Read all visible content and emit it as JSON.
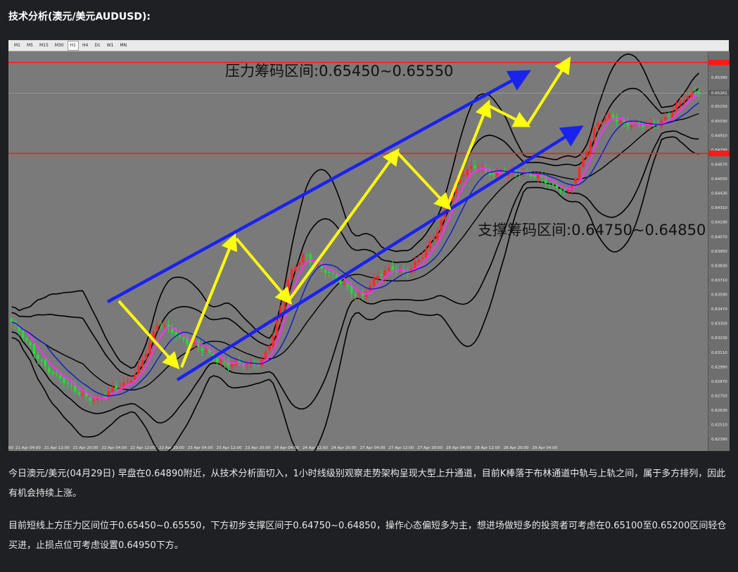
{
  "page": {
    "title": "技术分析(澳元/美元AUDUSD):",
    "paragraph1": "今日澳元/美元(04月29日) 早盘在0.64890附近，从技术分析面切入，1小时线级别观察走势架构呈现大型上升通道，目前K棒落于布林通道中轨与上轨之间，属于多方排列，因此有机会持续上涨。",
    "paragraph2": "目前短线上方压力区间位于0.65450~0.65550，下方初步支撑区间于0.64750~0.64850，操作心态偏短多为主，想进场做短多的投资者可考虑在0.65100至0.65200区间轻仓买进，止损点位可考虑设置0.64950下方。"
  },
  "toolbar": {
    "timeframes": [
      "M1",
      "M5",
      "M15",
      "M30",
      "H1",
      "H4",
      "D1",
      "W1",
      "MN"
    ],
    "active": "H1"
  },
  "chart_data": {
    "type": "candlestick",
    "symbol": "AUDUSD",
    "timeframe": "H1",
    "annotations": {
      "resistance": "压力筹码区间:0.65450~0.65550",
      "support": "支撑筹码区间:0.64750~0.64850"
    },
    "resistance_level": 0.65515,
    "support_level": 0.6476,
    "current_price": 0.65261,
    "price_axis": {
      "ticks": [
        "0.65390",
        "0.65261",
        "0.65150",
        "0.65030",
        "0.64910",
        "0.64790",
        "0.64670",
        "0.64550",
        "0.64430",
        "0.64310",
        "0.64190",
        "0.64070",
        "0.63950",
        "0.63830",
        "0.63710",
        "0.63590",
        "0.63470",
        "0.63350",
        "0.63230",
        "0.63110",
        "0.62990",
        "0.62870",
        "0.62750",
        "0.62630",
        "0.62510",
        "0.62390"
      ],
      "ylim": [
        0.6235,
        0.6556
      ]
    },
    "time_axis": {
      "ticks": [
        "00",
        "21 Apr 04:00",
        "21 Apr 12:00",
        "21 Apr 20:00",
        "22 Apr 04:00",
        "22 Apr 12:00",
        "22 Apr 20:00",
        "23 Apr 04:00",
        "23 Apr 12:00",
        "23 Apr 20:00",
        "24 Apr 04:00",
        "24 Apr 12:00",
        "24 Apr 20:00",
        "27 Apr 04:00",
        "27 Apr 12:00",
        "27 Apr 20:00",
        "28 Apr 04:00",
        "28 Apr 12:00",
        "28 Apr 20:00",
        "29 Apr 04:00"
      ]
    },
    "price_path": [
      0.6336,
      0.6318,
      0.6305,
      0.6292,
      0.628,
      0.6276,
      0.6272,
      0.6279,
      0.6288,
      0.6306,
      0.6333,
      0.633,
      0.632,
      0.6312,
      0.6306,
      0.6302,
      0.6299,
      0.6303,
      0.633,
      0.6373,
      0.6394,
      0.6382,
      0.6372,
      0.6365,
      0.6358,
      0.6372,
      0.6382,
      0.6378,
      0.6387,
      0.641,
      0.6442,
      0.646,
      0.6465,
      0.646,
      0.6458,
      0.6461,
      0.6459,
      0.6446,
      0.6444,
      0.647,
      0.6498,
      0.6508,
      0.6502,
      0.6497,
      0.65,
      0.651,
      0.652,
      0.6527
    ],
    "colors": {
      "bull_candle": "#ff2a2a",
      "bear_candle": "#22dd33",
      "bollinger": "#000000",
      "ma_blue": "#0a1dcc",
      "ma_magenta": "#ff2cff",
      "channel": "#1a22ee",
      "arrows": "#ffff10",
      "levels": "#ff1a1a"
    }
  }
}
